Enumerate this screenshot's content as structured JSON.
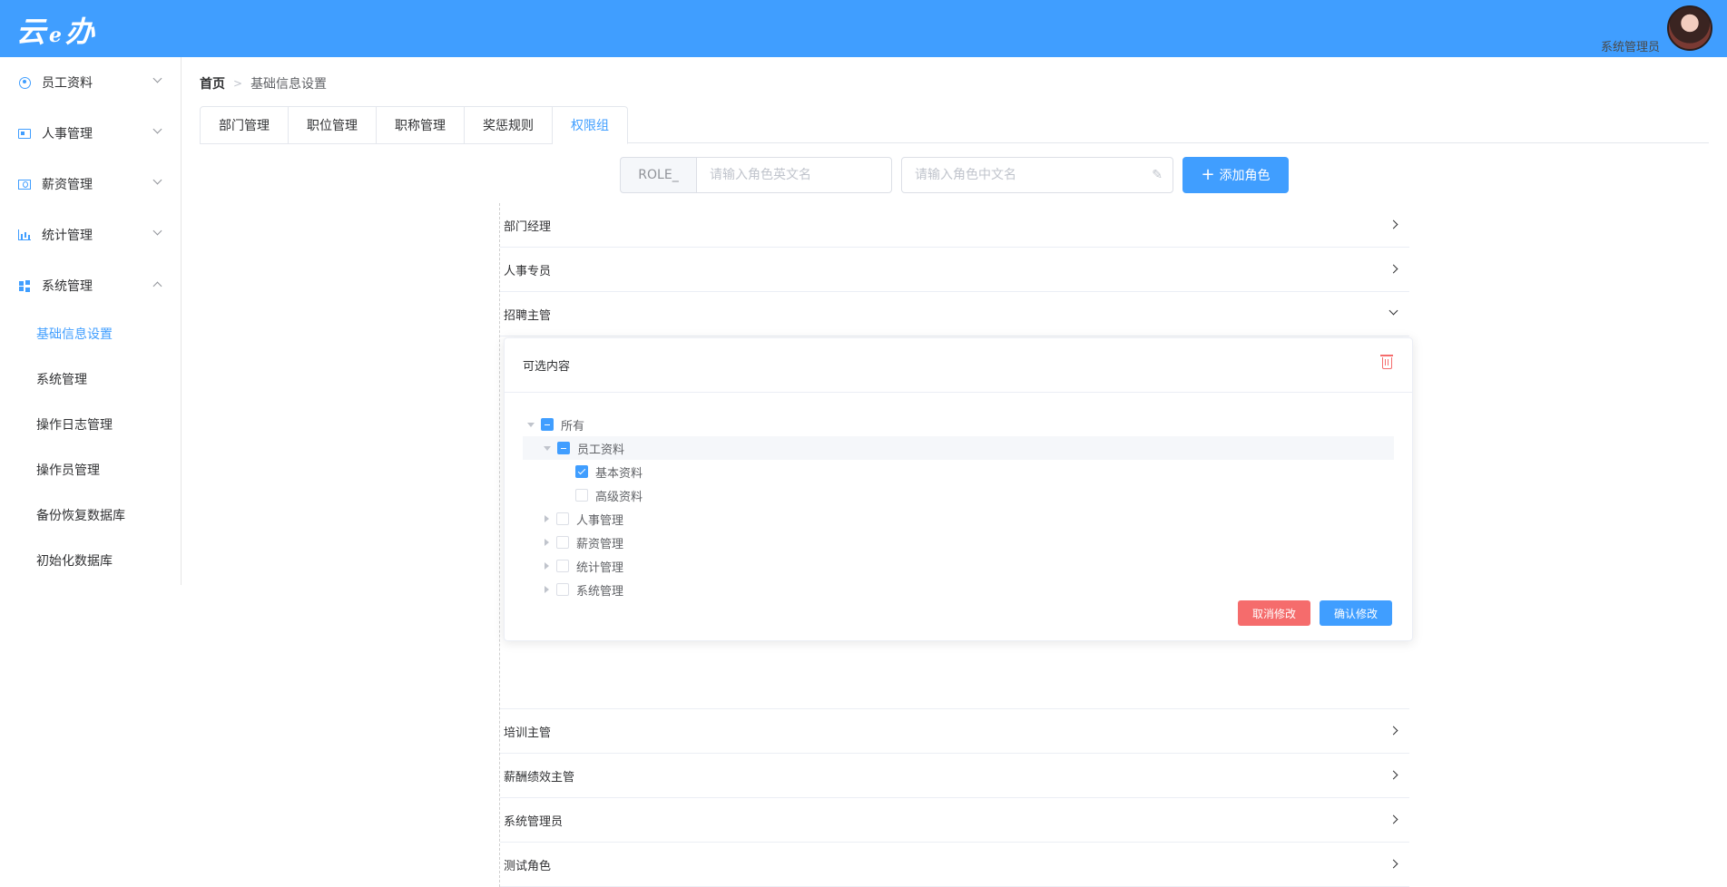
{
  "header": {
    "logo_main": "云",
    "logo_e": "e",
    "logo_tail": "办",
    "user_name": "系统管理员"
  },
  "sidebar": {
    "menus": [
      {
        "label": "员工资料",
        "icon": "user-circle-icon",
        "expanded": false
      },
      {
        "label": "人事管理",
        "icon": "id-card-icon",
        "expanded": false
      },
      {
        "label": "薪资管理",
        "icon": "money-icon",
        "expanded": false
      },
      {
        "label": "统计管理",
        "icon": "bar-chart-icon",
        "expanded": false
      },
      {
        "label": "系统管理",
        "icon": "windows-icon",
        "expanded": true
      }
    ],
    "sub_items": [
      {
        "label": "基础信息设置",
        "active": true
      },
      {
        "label": "系统管理",
        "active": false
      },
      {
        "label": "操作日志管理",
        "active": false
      },
      {
        "label": "操作员管理",
        "active": false
      },
      {
        "label": "备份恢复数据库",
        "active": false
      },
      {
        "label": "初始化数据库",
        "active": false
      }
    ]
  },
  "breadcrumb": {
    "home": "首页",
    "separator": ">",
    "current": "基础信息设置"
  },
  "tabs": [
    "部门管理",
    "职位管理",
    "职称管理",
    "奖惩规则",
    "权限组"
  ],
  "active_tab": "权限组",
  "role_form": {
    "prefix": "ROLE_",
    "en_placeholder": "请输入角色英文名",
    "cn_placeholder": "请输入角色中文名",
    "add_label": "添加角色"
  },
  "roles_before": [
    "部门经理",
    "人事专员",
    "招聘主管"
  ],
  "roles_after": [
    "培训主管",
    "薪酬绩效主管",
    "系统管理员",
    "测试角色"
  ],
  "expanded_role": "招聘主管",
  "card": {
    "title": "可选内容",
    "tree": [
      {
        "label": "所有",
        "level": 1,
        "state": "indeterminate",
        "expander": "open"
      },
      {
        "label": "员工资料",
        "level": 2,
        "state": "indeterminate",
        "expander": "open",
        "highlight": true
      },
      {
        "label": "基本资料",
        "level": 3,
        "state": "checked",
        "expander": "none"
      },
      {
        "label": "高级资料",
        "level": 3,
        "state": "unchecked",
        "expander": "none"
      },
      {
        "label": "人事管理",
        "level": 2,
        "state": "unchecked",
        "expander": "closed"
      },
      {
        "label": "薪资管理",
        "level": 2,
        "state": "unchecked",
        "expander": "closed"
      },
      {
        "label": "统计管理",
        "level": 2,
        "state": "unchecked",
        "expander": "closed"
      },
      {
        "label": "系统管理",
        "level": 2,
        "state": "unchecked",
        "expander": "closed"
      }
    ],
    "cancel_label": "取消修改",
    "confirm_label": "确认修改"
  },
  "colors": {
    "primary": "#409eff",
    "danger": "#f56c6c"
  }
}
